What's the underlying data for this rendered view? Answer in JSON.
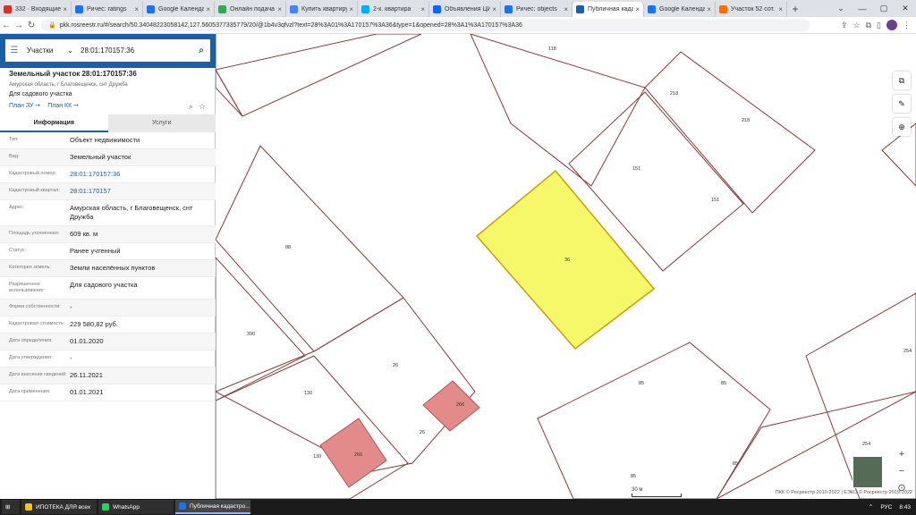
{
  "browser": {
    "tabs": [
      {
        "label": "332 · Входящие",
        "color": "#d93025"
      },
      {
        "label": "Ричес: ratings",
        "color": "#1a73e8"
      },
      {
        "label": "Google Календарь",
        "color": "#1a73e8"
      },
      {
        "label": "Онлайн подача",
        "color": "#34a853"
      },
      {
        "label": "Купить квартиру",
        "color": "#4285f4"
      },
      {
        "label": "2-к. квартира",
        "color": "#00aaff"
      },
      {
        "label": "Объявления ЦИАН",
        "color": "#0468ff"
      },
      {
        "label": "Ричес: objects",
        "color": "#1a73e8"
      },
      {
        "label": "Публичная кадастровая",
        "color": "#1a5fa8",
        "active": true
      },
      {
        "label": "Google Календарь",
        "color": "#1a73e8"
      },
      {
        "label": "Участок 52 сот.",
        "color": "#ff6f00"
      }
    ],
    "url": "pkk.rosreestr.ru/#/search/50.34048223058142,127.5605377335779/20/@1b4v3qfvzl?text=28%3A01%3A170157%3A36&type=1&opened=28%3A1%3A170157%3A36",
    "profile_initial": "Л"
  },
  "search": {
    "category": "Участки",
    "query": "28:01:170157:36"
  },
  "object": {
    "title": "Земельный участок 28:01:170157:36",
    "address": "Амурская область, г Благовещенск, снт Дружба",
    "purpose": "Для садового участка",
    "link_zu": "План ЗУ ➙",
    "link_kk": "План КК ➙"
  },
  "tabs": {
    "info": "Информация",
    "services": "Услуги"
  },
  "rows": [
    {
      "key": "Тип:",
      "value": "Объект недвижимости"
    },
    {
      "key": "Вид:",
      "value": "Земельный участок"
    },
    {
      "key": "Кадастровый номер:",
      "value": "28:01:170157:36",
      "link": true
    },
    {
      "key": "Кадастровый квартал:",
      "value": "28:01:170157",
      "link": true
    },
    {
      "key": "Адрес:",
      "value": "Амурская область, г Благовещенск, снт Дружба"
    },
    {
      "key": "Площадь уточненная:",
      "value": "609 кв. м"
    },
    {
      "key": "Статус:",
      "value": "Ранее учтенный"
    },
    {
      "key": "Категория земель:",
      "value": "Земли населённых пунктов"
    },
    {
      "key": "Разрешенное использование:",
      "value": "Для садового участка"
    },
    {
      "key": "Форма собственности:",
      "value": "-"
    },
    {
      "key": "Кадастровая стоимость:",
      "value": "229 580,82 руб."
    },
    {
      "key": "Дата определения:",
      "value": "01.01.2020"
    },
    {
      "key": "Дата утверждения:",
      "value": "-"
    },
    {
      "key": "Дата внесения сведений:",
      "value": "26.11.2021"
    },
    {
      "key": "Дата применения:",
      "value": "01.01.2021"
    }
  ],
  "map": {
    "parcel_labels": [
      "118",
      "218",
      "218",
      "151",
      "151",
      "36",
      "88",
      "390",
      "26",
      "26",
      "130",
      "130",
      "85",
      "85",
      "85",
      "85",
      "254",
      "254",
      "266",
      "266"
    ],
    "scale_label": "30 м",
    "copyright": "ПКК © Росреестр 2010-2022 | ЕЭКО © Росреестр 2019-2022"
  },
  "taskbar": {
    "items": [
      {
        "label": "ИПОТЕКА ДЛЯ всех",
        "color": "#f5c518"
      },
      {
        "label": "WhatsApp",
        "color": "#25d366"
      },
      {
        "label": "Публичная кадастро...",
        "color": "#1a73e8",
        "active": true
      }
    ],
    "lang": "РУС",
    "time": "8:43"
  },
  "colors": {
    "accent": "#1a5fa8",
    "selected_parcel": "#f7f76a",
    "building": "#e88d8d"
  }
}
